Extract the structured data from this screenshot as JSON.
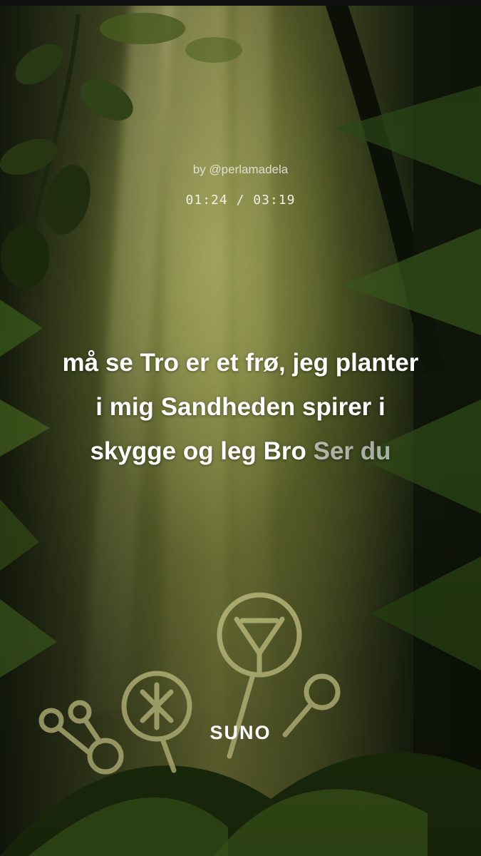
{
  "credit": "by @perlamadela",
  "time": {
    "elapsed": "01:24",
    "separator": "/",
    "total": "03:19"
  },
  "lyrics": {
    "lines": [
      {
        "sung": "må se Tro er et frø, jeg planter",
        "upcoming": ""
      },
      {
        "sung": "i mig Sandheden spirer i",
        "upcoming": ""
      },
      {
        "sung": "skygge og leg Bro",
        "upcoming": "Ser du"
      }
    ]
  },
  "brand": "SUNO",
  "icons": {
    "background": "forest-illustration",
    "runes": "glowing-rune-symbols"
  },
  "colors": {
    "text": "#ffffff",
    "upcoming_text": "#c9ccbd",
    "glow": "#e6e39a"
  }
}
